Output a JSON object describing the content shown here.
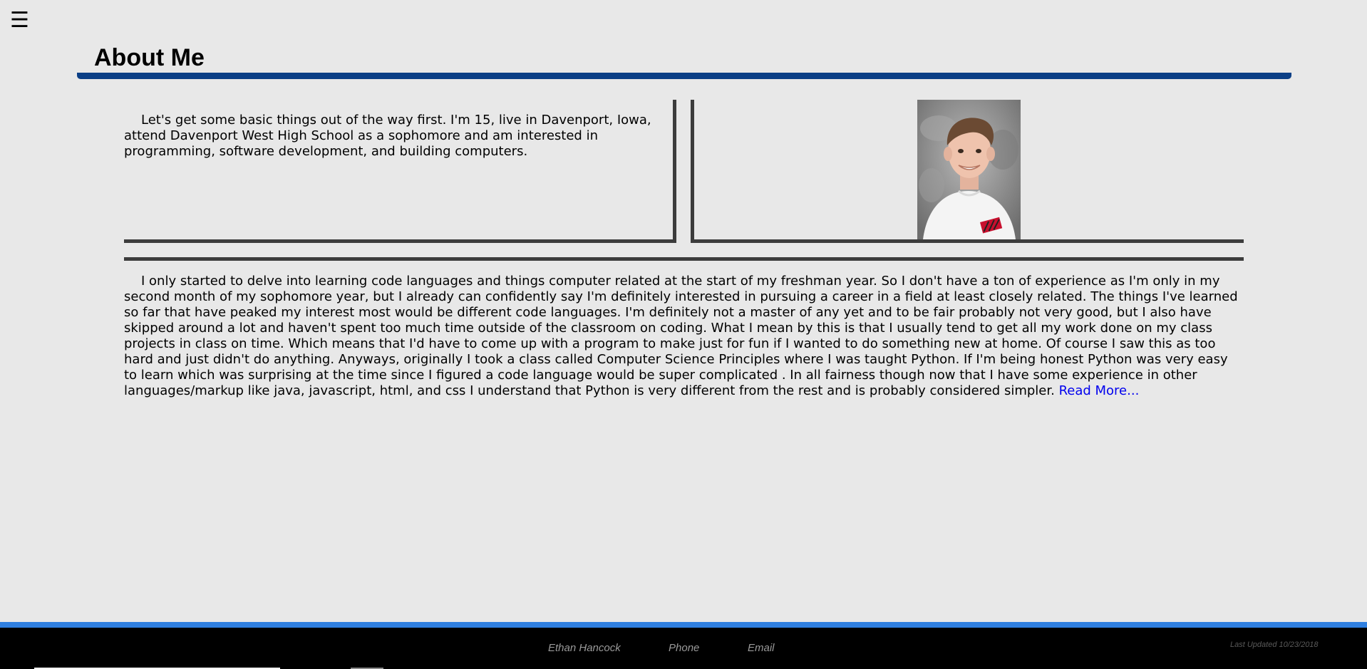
{
  "nav": {
    "menu_icon": "☰"
  },
  "header": {
    "title": "About Me"
  },
  "intro": {
    "text": "Let's get some basic things out of the way first. I'm 15, live in Davenport, Iowa, attend Davenport West High School as a sophomore and am interested in programming, software development, and building computers."
  },
  "portrait": {
    "alt": "Portrait"
  },
  "about": {
    "text": "I only started to delve into learning code languages and things computer related at the start of my freshman year. So I don't have a ton of experience as I'm only in my second month of my sophomore year, but I already can confidently say I'm definitely interested in pursuing a career in a field at least closely related. The things I've learned so far that have peaked my interest most would be different code languages. I'm definitely not a master of any yet and to be fair probably not very good, but I also have skipped around a lot and haven't spent too much time outside of the classroom on coding. What I mean by this is that I usually tend to get all my work done on my class projects in class on time. Which means that I'd have to come up with a program to make just for fun if I wanted to do something new at home. Of course I saw this as too hard and just didn't do anything. Anyways, originally I took a class called Computer Science Principles where I was taught Python. If I'm being honest Python was very easy to learn which was surprising at the time since I figured a code language would be super complicated . In all fairness though now that I have some experience in other languages/markup like java, javascript, html, and css I understand that Python is very different from the rest and is probably considered simpler.",
    "read_more": "Read More..."
  },
  "footer": {
    "name": "Ethan Hancock",
    "phone": "Phone",
    "email": "Email",
    "last_updated": "Last Updated 10/23/2018"
  },
  "colors": {
    "background": "#e8e8e8",
    "title_rule": "#0b3f86",
    "footer_accent": "#2f7fe0",
    "footer_bg": "#000000",
    "link": "#0000ee"
  }
}
